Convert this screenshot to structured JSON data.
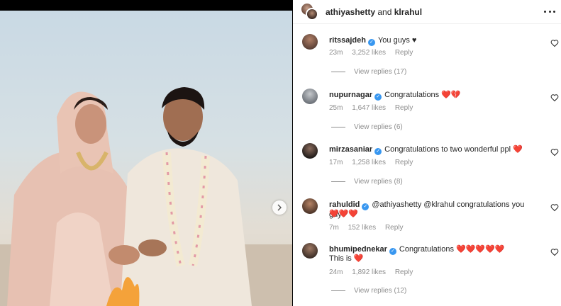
{
  "header": {
    "user1": "athiyashetty",
    "joiner": "and",
    "user2": "klrahul",
    "more_icon": "more-horizontal-icon"
  },
  "photo": {
    "alt": "",
    "next_icon": "chevron-right-icon"
  },
  "comments": [
    {
      "username": "ritssajdeh",
      "verified": true,
      "text": "You guys ♥",
      "time": "23m",
      "likes": "3,252 likes",
      "reply": "Reply",
      "view_replies": "View replies (17)",
      "avatar_color": "#5a4036"
    },
    {
      "username": "nupurnagar",
      "verified": true,
      "text": "Congratulations ❤️💔",
      "time": "25m",
      "likes": "1,647 likes",
      "reply": "Reply",
      "view_replies": "View replies (6)",
      "avatar_color": "#8a8f96"
    },
    {
      "username": "mirzasaniar",
      "verified": true,
      "text": "Congratulations to two wonderful ppl ❤️",
      "time": "17m",
      "likes": "1,258 likes",
      "reply": "Reply",
      "view_replies": "View replies (8)",
      "avatar_color": "#2b2624"
    },
    {
      "username": "rahuldid",
      "verified": true,
      "text": "@athiyashetty @klrahul congratulations you guys",
      "text2": "❤️❤️❤️",
      "time": "7m",
      "likes": "152 likes",
      "reply": "Reply",
      "view_replies": "",
      "avatar_color": "#6b4b3b"
    },
    {
      "username": "bhumipednekar",
      "verified": true,
      "text": "Congratulations ❤️❤️❤️❤️❤️",
      "text2": "This is ❤️",
      "time": "24m",
      "likes": "1,892 likes",
      "reply": "Reply",
      "view_replies": "View replies (12)",
      "avatar_color": "#4a3a30"
    }
  ],
  "colors": {
    "verified": "#3897f0",
    "heart": "#e0243c",
    "meta": "#8e8e8e"
  }
}
